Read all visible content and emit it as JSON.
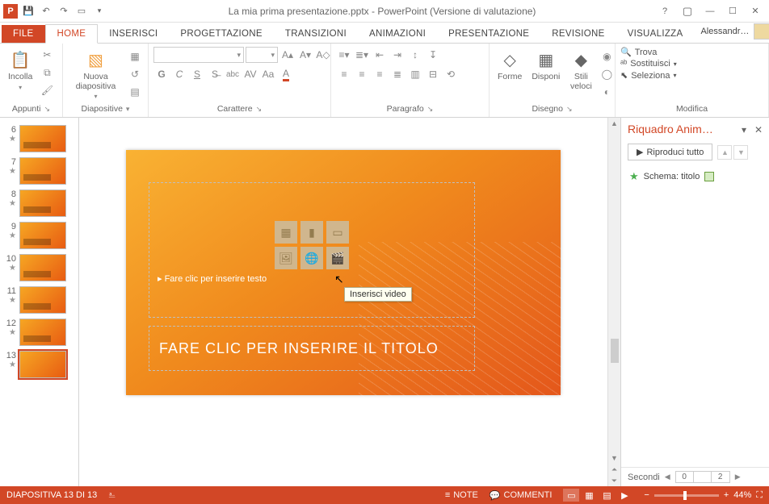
{
  "app": {
    "title": "La mia prima presentazione.pptx - PowerPoint (Versione di valutazione)"
  },
  "tabs": {
    "file": "FILE",
    "items": [
      "HOME",
      "INSERISCI",
      "PROGETTAZIONE",
      "TRANSIZIONI",
      "ANIMAZIONI",
      "PRESENTAZIONE",
      "REVISIONE",
      "VISUALIZZA"
    ],
    "active": "HOME",
    "user": "Alessandr…"
  },
  "ribbon": {
    "clipboard": {
      "paste": "Incolla",
      "label": "Appunti"
    },
    "slides": {
      "new": "Nuova diapositiva",
      "label": "Diapositive"
    },
    "font": {
      "label": "Carattere",
      "family": "",
      "size": ""
    },
    "para": {
      "label": "Paragrafo"
    },
    "draw": {
      "shapes": "Forme",
      "arrange": "Disponi",
      "styles": "Stili veloci",
      "label": "Disegno"
    },
    "edit": {
      "find": "Trova",
      "replace": "Sostituisci",
      "select": "Seleziona",
      "label": "Modifica"
    }
  },
  "thumbs": [
    {
      "n": "6"
    },
    {
      "n": "7"
    },
    {
      "n": "8"
    },
    {
      "n": "9"
    },
    {
      "n": "10"
    },
    {
      "n": "11"
    },
    {
      "n": "12"
    },
    {
      "n": "13",
      "sel": true
    }
  ],
  "slide": {
    "content_prompt": "Fare clic per inserire testo",
    "title_prompt": "FARE CLIC PER INSERIRE IL TITOLO",
    "tooltip": "Inserisci video"
  },
  "animpane": {
    "title": "Riquadro Anim…",
    "play": "Riproduci tutto",
    "item": "Schema: titolo",
    "seconds": "Secondi",
    "tl": [
      "0",
      "",
      "2"
    ]
  },
  "status": {
    "slide": "DIAPOSITIVA 13 DI 13",
    "notes": "NOTE",
    "comments": "COMMENTI",
    "zoom": "44%"
  }
}
